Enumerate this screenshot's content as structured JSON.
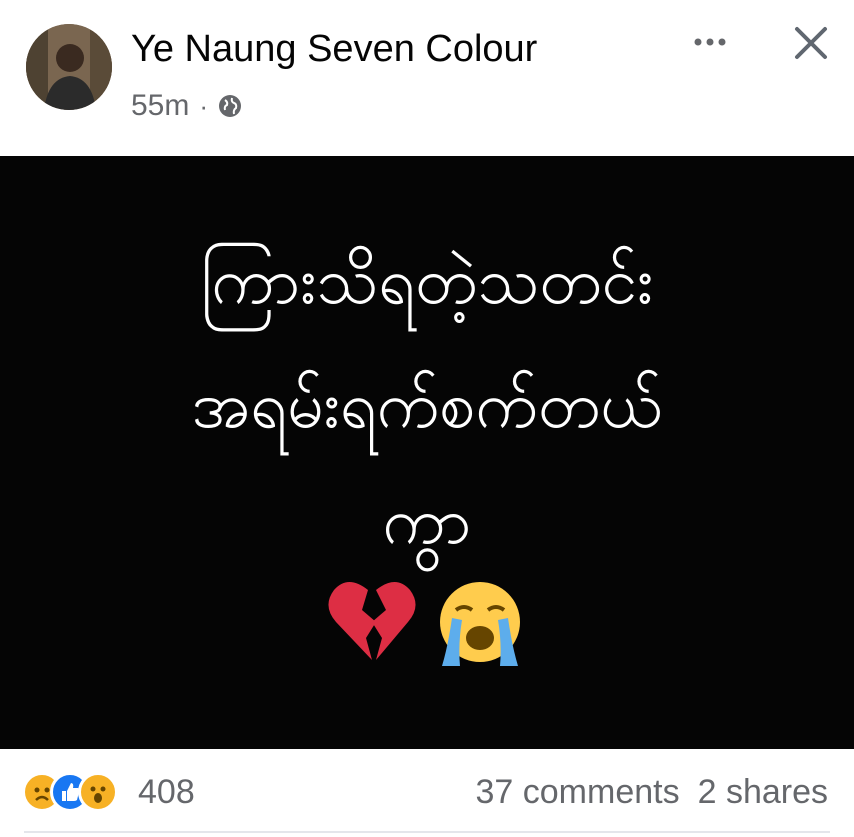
{
  "post": {
    "author": "Ye Naung Seven Colour",
    "time": "55m",
    "separator": "·",
    "privacy_icon": "globe-icon",
    "more_icon": "more-options-icon",
    "close_icon": "close-icon"
  },
  "image": {
    "lines": [
      "ကြားသိရတဲ့သတင်း",
      "အရမ်းရက်စက်တယ်",
      "ကွာ"
    ],
    "emojis": [
      "broken-heart-icon",
      "loudly-crying-face-icon"
    ],
    "background": "#050505"
  },
  "footer": {
    "reaction_icons": [
      "sad-reaction-icon",
      "like-reaction-icon",
      "wow-reaction-icon"
    ],
    "reaction_count": "408",
    "comments": "37 comments",
    "shares": "2 shares"
  },
  "colors": {
    "primary_text": "#050505",
    "secondary_text": "#65676b",
    "like_blue": "#1877f2"
  }
}
